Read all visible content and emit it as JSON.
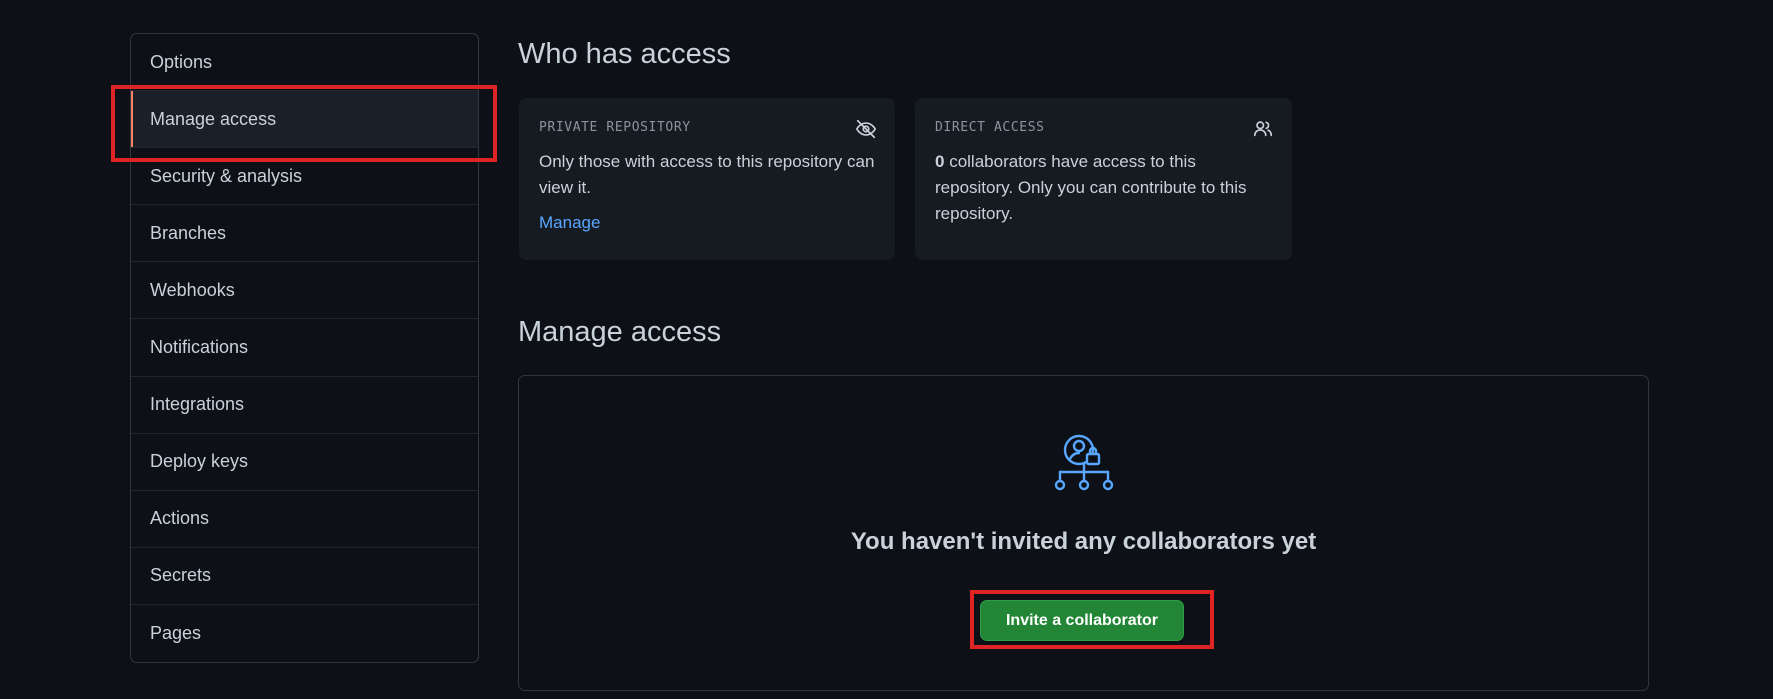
{
  "sidebar": {
    "items": [
      {
        "label": "Options"
      },
      {
        "label": "Manage access"
      },
      {
        "label": "Security & analysis"
      },
      {
        "label": "Branches"
      },
      {
        "label": "Webhooks"
      },
      {
        "label": "Notifications"
      },
      {
        "label": "Integrations"
      },
      {
        "label": "Deploy keys"
      },
      {
        "label": "Actions"
      },
      {
        "label": "Secrets"
      },
      {
        "label": "Pages"
      }
    ],
    "selected_index": 1
  },
  "who_has_access": {
    "title": "Who has access",
    "private_card": {
      "label": "PRIVATE REPOSITORY",
      "icon": "eye-closed-icon",
      "text": "Only those with access to this repository can view it.",
      "link": "Manage"
    },
    "direct_card": {
      "label": "DIRECT ACCESS",
      "icon": "people-icon",
      "count": "0",
      "text": " collaborators have access to this repository. Only you can contribute to this repository."
    }
  },
  "manage_access": {
    "title": "Manage access",
    "icon": "person-lock-network-icon",
    "empty_message": "You haven't invited any collaborators yet",
    "invite_button": "Invite a collaborator"
  },
  "colors": {
    "background": "#0d1117",
    "card": "#161b22",
    "accent_link": "#58a6ff",
    "primary_button": "#238636",
    "selected_indicator": "#f78166",
    "annotation_box": "#e02424"
  }
}
